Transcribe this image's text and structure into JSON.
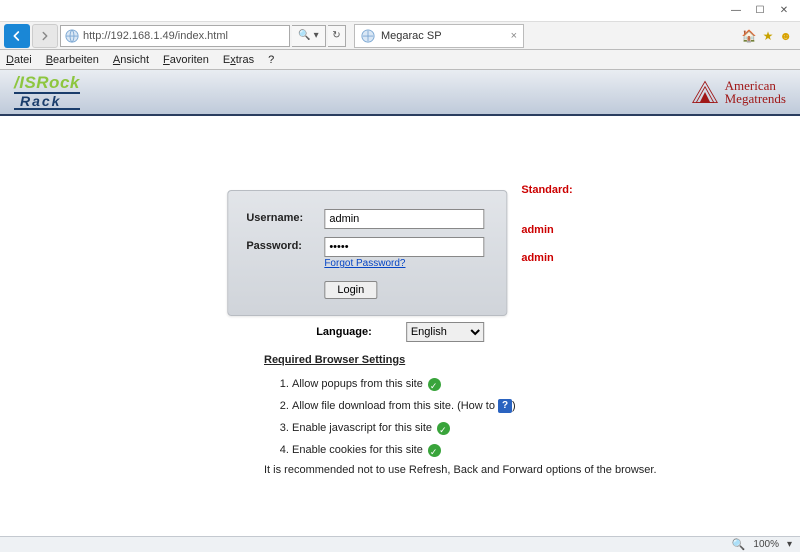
{
  "window": {
    "min": "—",
    "max": "☐",
    "close": "✕"
  },
  "browser": {
    "url": "http://192.168.1.49/index.html",
    "search_hint": "🔍 ▾",
    "refresh": "↻",
    "tab_title": "Megarac SP",
    "tab_close": "×",
    "home": "🏠",
    "star": "★",
    "gear": "☻",
    "menu": {
      "datei": "Datei",
      "bearbeiten": "Bearbeiten",
      "ansicht": "Ansicht",
      "favoriten": "Favoriten",
      "extras": "Extras",
      "hilfe": "?"
    }
  },
  "brand": {
    "asrock1": "/ISRock",
    "asrock2": "Rack",
    "ami1": "American",
    "ami2": "Megatrends"
  },
  "login": {
    "username_label": "Username:",
    "password_label": "Password:",
    "username_value": "admin",
    "password_value": "•••••",
    "forgot": "Forgot Password?",
    "login_btn": "Login"
  },
  "hints": {
    "standard": "Standard:",
    "user": "admin",
    "pass": "admin"
  },
  "lang": {
    "label": "Language:",
    "value": "English"
  },
  "req": {
    "heading": "Required Browser Settings",
    "items": [
      "Allow popups from this site",
      "Allow file download from this site. (How to",
      "Enable javascript for this site",
      "Enable cookies for this site"
    ],
    "howto_close": ")",
    "note": "It is recommended not to use Refresh, Back and Forward options of the browser."
  },
  "status": {
    "zoom": "100%",
    "drop": "▾"
  }
}
